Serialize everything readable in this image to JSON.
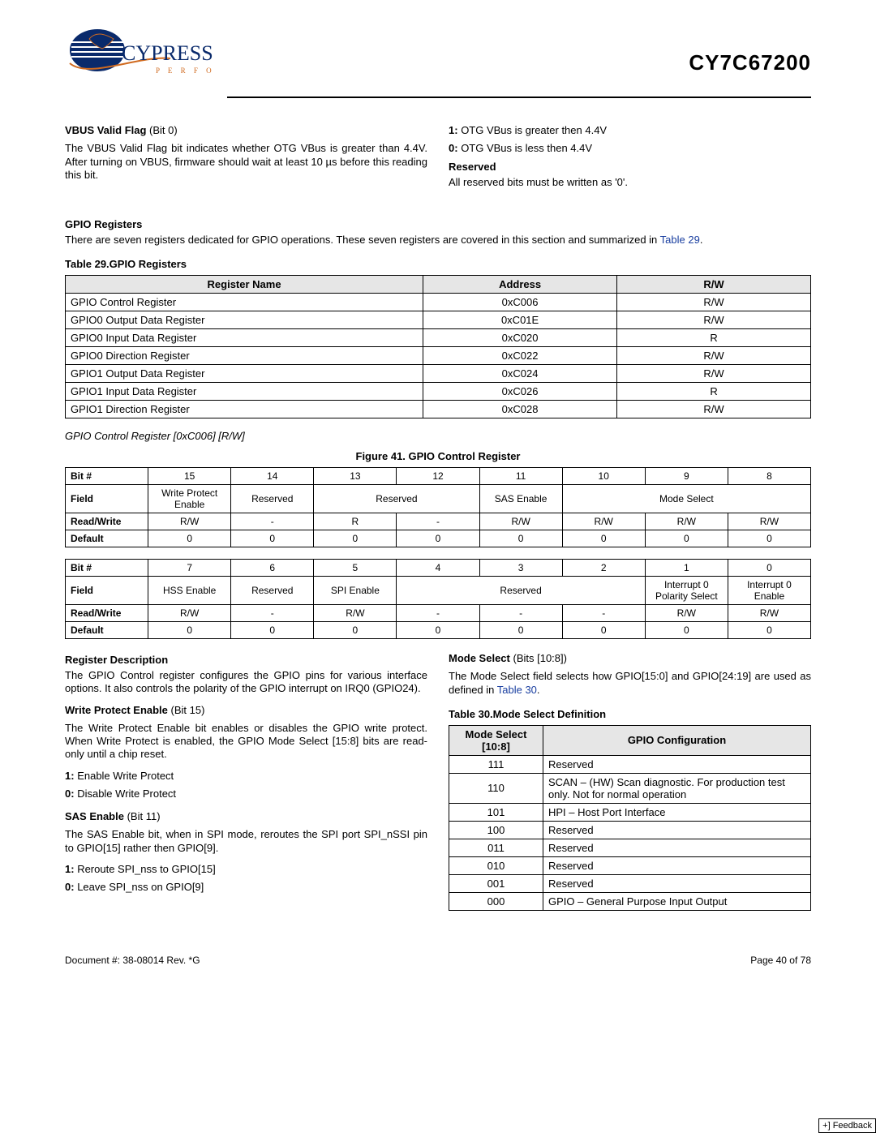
{
  "header": {
    "part_number": "CY7C67200",
    "logo_brand": "CYPRESS",
    "logo_tagline": "P E R F O R M"
  },
  "vbus": {
    "title": "VBUS Valid Flag",
    "title_bit": "(Bit 0)",
    "body": "The VBUS Valid Flag bit indicates whether OTG VBus is greater than 4.4V. After turning on VBUS, firmware should wait at least 10 µs before this reading this bit.",
    "val1": "1: OTG VBus is greater then 4.4V",
    "val0": "0: OTG VBus is less then 4.4V"
  },
  "reserved": {
    "title": "Reserved",
    "body": "All reserved bits must be written as '0'."
  },
  "gpio_reg_section": {
    "title": "GPIO Registers",
    "body_a": "There are seven registers dedicated for GPIO operations. These seven registers are covered in this section and summarized in ",
    "body_link": "Table 29",
    "body_b": "."
  },
  "table29": {
    "caption": "Table 29.GPIO Registers",
    "headers": [
      "Register Name",
      "Address",
      "R/W"
    ],
    "rows": [
      [
        "GPIO Control Register",
        "0xC006",
        "R/W"
      ],
      [
        "GPIO0 Output Data Register",
        "0xC01E",
        "R/W"
      ],
      [
        "GPIO0 Input Data Register",
        "0xC020",
        "R"
      ],
      [
        "GPIO0 Direction Register",
        "0xC022",
        "R/W"
      ],
      [
        "GPIO1 Output Data Register",
        "0xC024",
        "R/W"
      ],
      [
        "GPIO1 Input Data Register",
        "0xC026",
        "R"
      ],
      [
        "GPIO1 Direction Register",
        "0xC028",
        "R/W"
      ]
    ]
  },
  "gpio_ctrl_sub": "GPIO Control Register [0xC006] [R/W]",
  "fig41_caption": "Figure 41. GPIO Control Register",
  "regA": {
    "bit_label": "Bit #",
    "field_label": "Field",
    "rw_label": "Read/Write",
    "def_label": "Default",
    "bits": [
      "15",
      "14",
      "13",
      "12",
      "11",
      "10",
      "9",
      "8"
    ],
    "fields": [
      "Write Protect Enable",
      "Reserved",
      "Reserved",
      "",
      "SAS Enable",
      "Mode Select",
      "",
      ""
    ],
    "rw": [
      "R/W",
      "-",
      "R",
      "-",
      "R/W",
      "R/W",
      "R/W",
      "R/W"
    ],
    "def": [
      "0",
      "0",
      "0",
      "0",
      "0",
      "0",
      "0",
      "0"
    ]
  },
  "regB": {
    "bits": [
      "7",
      "6",
      "5",
      "4",
      "3",
      "2",
      "1",
      "0"
    ],
    "fields": [
      "HSS Enable",
      "Reserved",
      "SPI Enable",
      "Reserved",
      "",
      "",
      "Interrupt 0 Polarity Select",
      "Interrupt 0 Enable"
    ],
    "rw": [
      "R/W",
      "-",
      "R/W",
      "-",
      "-",
      "-",
      "R/W",
      "R/W"
    ],
    "def": [
      "0",
      "0",
      "0",
      "0",
      "0",
      "0",
      "0",
      "0"
    ]
  },
  "reg_desc": {
    "title": "Register Description",
    "body": "The GPIO Control register configures the GPIO pins for various interface options. It also controls the polarity of the GPIO interrupt on IRQ0 (GPIO24)."
  },
  "wpe": {
    "title": "Write Protect Enable",
    "title_bit": "(Bit 15)",
    "body": "The Write Protect Enable bit enables or disables the GPIO write protect. When Write Protect is enabled, the GPIO Mode Select [15:8] bits are read-only until a chip reset.",
    "v1": "1: Enable Write Protect",
    "v0": "0: Disable Write Protect"
  },
  "sas": {
    "title": "SAS Enable",
    "title_bit": "(Bit 11)",
    "body": "The SAS Enable bit, when in SPI mode, reroutes the SPI port SPI_nSSI pin to GPIO[15] rather then GPIO[9].",
    "v1": "1: Reroute SPI_nss to GPIO[15]",
    "v0": "0: Leave SPI_nss on GPIO[9]"
  },
  "mode_sel": {
    "title": "Mode Select",
    "title_bit": "(Bits [10:8])",
    "body_a": "The Mode Select field selects how GPIO[15:0] and GPIO[24:19] are used as defined in ",
    "body_link": "Table 30",
    "body_b": "."
  },
  "table30": {
    "caption": "Table 30.Mode Select Definition",
    "headers": [
      "Mode Select [10:8]",
      "GPIO Configuration"
    ],
    "rows": [
      [
        "111",
        "Reserved"
      ],
      [
        "110",
        "SCAN – (HW) Scan diagnostic. For production test only. Not for normal operation"
      ],
      [
        "101",
        "HPI – Host Port Interface"
      ],
      [
        "100",
        "Reserved"
      ],
      [
        "011",
        "Reserved"
      ],
      [
        "010",
        "Reserved"
      ],
      [
        "001",
        "Reserved"
      ],
      [
        "000",
        "GPIO – General Purpose Input Output"
      ]
    ]
  },
  "footer": {
    "doc": "Document #: 38-08014 Rev. *G",
    "page": "Page 40 of 78",
    "feedback": "+] Feedback"
  }
}
